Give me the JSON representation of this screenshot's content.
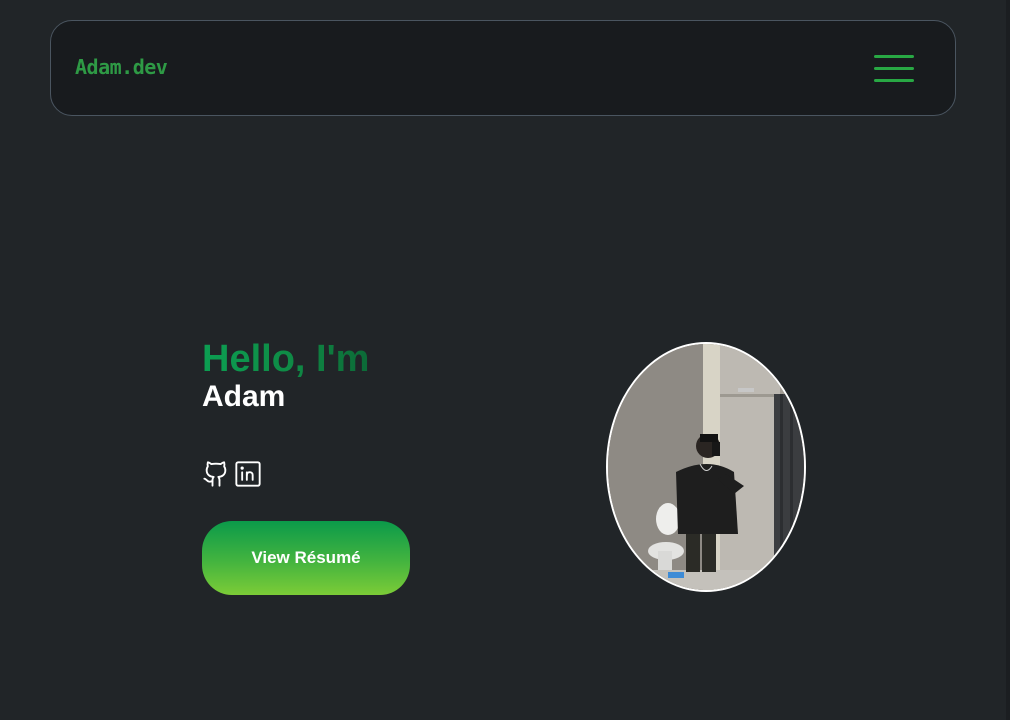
{
  "navbar": {
    "brand": "Adam.dev",
    "menu_icon": "hamburger-menu-icon",
    "accent_color": "#2e9a45"
  },
  "hero": {
    "greeting": "Hello, I'm",
    "name": "Adam",
    "resume_button": "View Résumé",
    "socials": [
      {
        "icon": "github-icon"
      },
      {
        "icon": "linkedin-icon"
      }
    ],
    "portrait_icon": "profile-photo"
  },
  "colors": {
    "background": "#212528",
    "greeting_gradient": [
      "#0c9e52",
      "#0c6a37"
    ],
    "button_gradient": [
      "#0b9a4a",
      "#7ccc37"
    ]
  }
}
